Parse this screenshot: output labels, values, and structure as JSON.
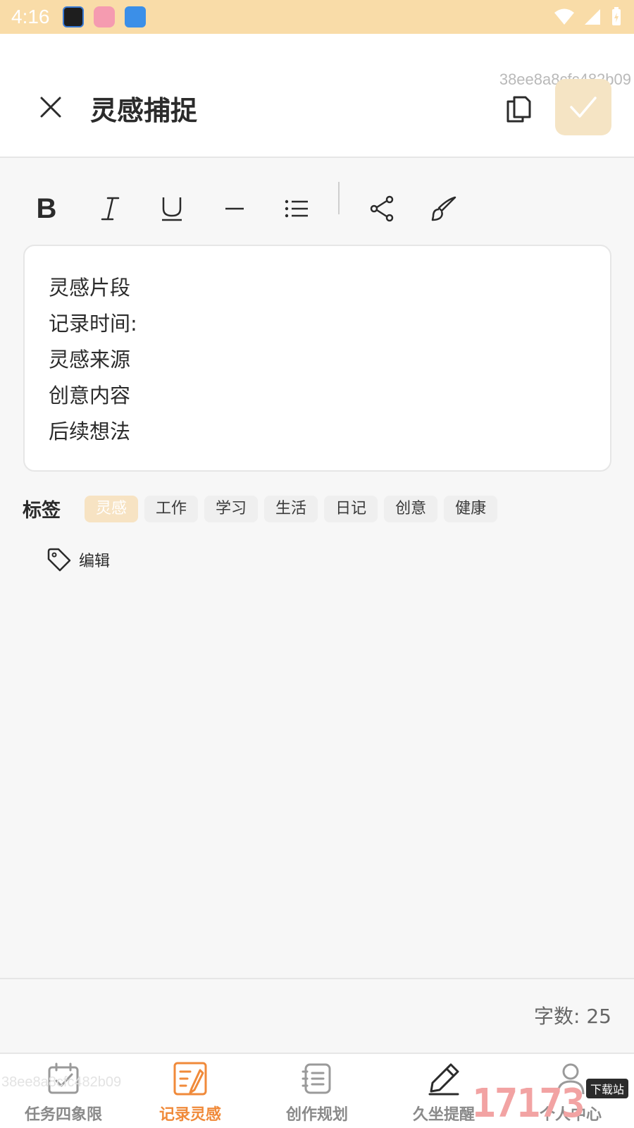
{
  "status_bar": {
    "time": "4:16"
  },
  "header": {
    "title": "灵感捕捉",
    "watermark_id": "38ee8a8cfc482b09",
    "accent_color": "#f5e4c4"
  },
  "toolbar": {
    "bold_label": "B",
    "icons": [
      "bold-icon",
      "italic-icon",
      "underline-icon",
      "horizontal-rule-icon",
      "list-icon",
      "share-icon",
      "brush-icon"
    ]
  },
  "editor": {
    "lines": [
      "灵感片段",
      "记录时间:",
      "灵感来源",
      "创意内容",
      "后续想法"
    ]
  },
  "tags": {
    "label": "标签",
    "items": [
      "灵感",
      "工作",
      "学习",
      "生活",
      "日记",
      "创意",
      "健康"
    ],
    "selected": "灵感",
    "edit_label": "编辑"
  },
  "footer": {
    "word_count_label": "字数:",
    "word_count_value": "25"
  },
  "bottom_nav": {
    "items": [
      {
        "label": "任务四象限",
        "icon": "calendar-check-icon"
      },
      {
        "label": "记录灵感",
        "icon": "note-edit-icon"
      },
      {
        "label": "创作规划",
        "icon": "planner-icon"
      },
      {
        "label": "久坐提醒",
        "icon": "pen-icon"
      },
      {
        "label": "个人中心",
        "icon": "user-icon"
      }
    ],
    "active_index": 1,
    "active_color": "#f08a3a",
    "ghost_text": "38ee8a8cfc482b09"
  },
  "corner_watermark": {
    "number": "17173",
    "tag": "下载站"
  }
}
